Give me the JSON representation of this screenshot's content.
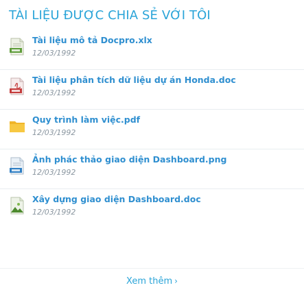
{
  "title": "TÀI LIỆU ĐƯỢC CHIA SẺ VỚI TÔI",
  "items": [
    {
      "name": "Tài liệu mô tả Docpro.xlx",
      "date": "12/03/1992",
      "icon": "spreadsheet-file-icon"
    },
    {
      "name": "Tài liệu phân tích dữ liệu dự án Honda.doc",
      "date": "12/03/1992",
      "icon": "pdf-file-icon"
    },
    {
      "name": "Quy trình làm việc.pdf",
      "date": "12/03/1992",
      "icon": "folder-icon"
    },
    {
      "name": "Ảnh phác thảo giao diện Dashboard.png",
      "date": "12/03/1992",
      "icon": "document-file-icon"
    },
    {
      "name": "Xây dựng giao diện Dashboard.doc",
      "date": "12/03/1992",
      "icon": "image-file-icon"
    }
  ],
  "footer": {
    "more_label": "Xem thêm",
    "chevron": "›"
  },
  "colors": {
    "accent": "#2aa4d8",
    "name": "#2f8fd0",
    "date": "#8a96a0"
  }
}
